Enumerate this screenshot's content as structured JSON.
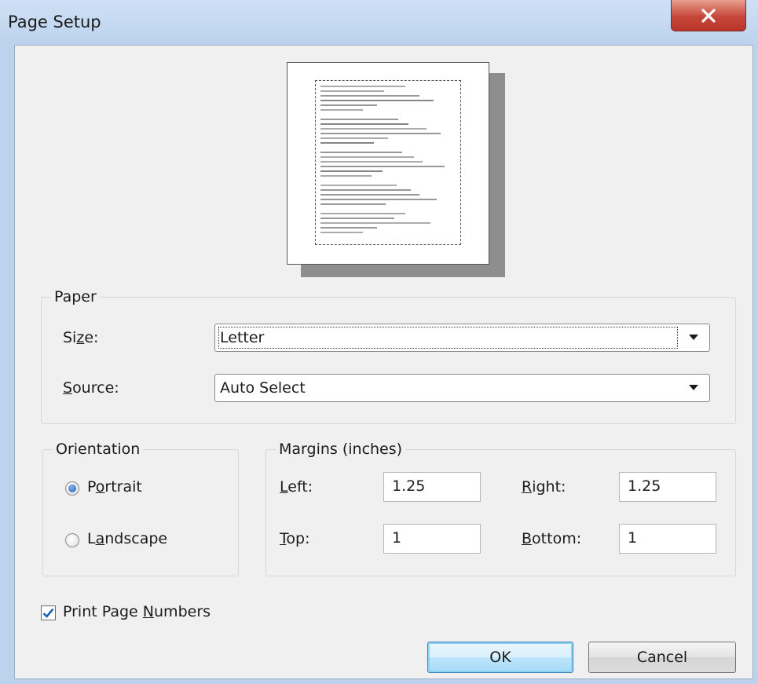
{
  "window": {
    "title": "Page Setup",
    "close_label": "X"
  },
  "paper": {
    "group_label": "Paper",
    "size_label": "Size:",
    "size_value": "Letter",
    "source_label": "Source:",
    "source_value": "Auto Select"
  },
  "orientation": {
    "group_label": "Orientation",
    "portrait_label": "Portrait",
    "landscape_label": "Landscape",
    "selected": "Portrait"
  },
  "margins": {
    "group_label": "Margins (inches)",
    "left_label": "Left:",
    "left_value": "1.25",
    "right_label": "Right:",
    "right_value": "1.25",
    "top_label": "Top:",
    "top_value": "1",
    "bottom_label": "Bottom:",
    "bottom_value": "1"
  },
  "print_page_numbers": {
    "label": "Print Page Numbers",
    "checked": true
  },
  "buttons": {
    "ok": "OK",
    "cancel": "Cancel"
  },
  "icons": {
    "close": "close-icon",
    "dropdown": "chevron-down-icon",
    "check": "checkmark-icon"
  },
  "colors": {
    "title_bar": "#bcd3ee",
    "client": "#f0f0f0",
    "close_button": "#c7463a",
    "radio_selected": "#1d5fb4",
    "default_button": "#3c7fb1"
  }
}
